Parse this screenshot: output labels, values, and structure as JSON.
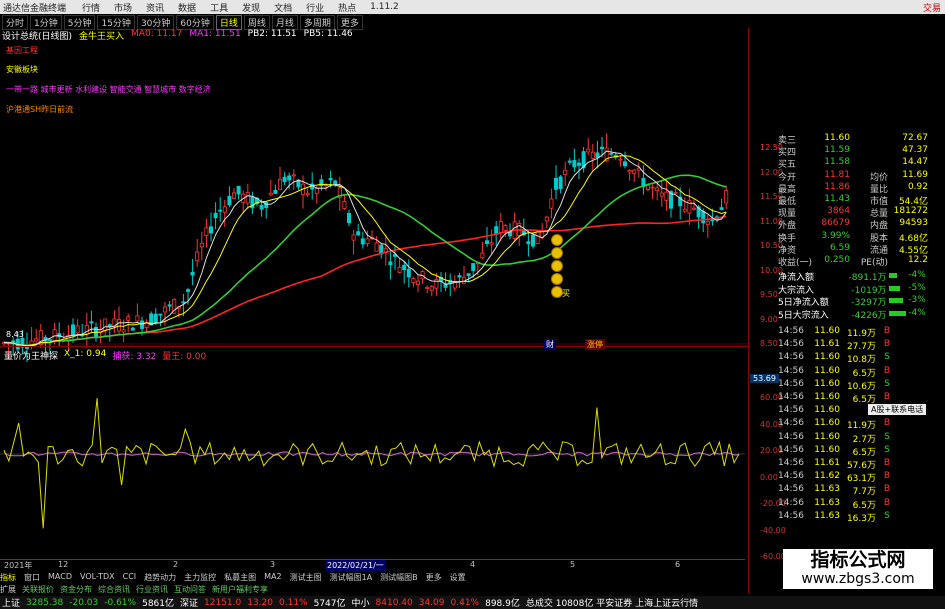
{
  "titlebar": {
    "app": "通达信金融终端",
    "menus": [
      "行情",
      "市场",
      "资讯",
      "数据",
      "工具",
      "发现",
      "文档",
      "行业",
      "热点",
      "1.11.2"
    ],
    "right": "交易"
  },
  "periods": [
    "分时",
    "1分钟",
    "5分钟",
    "15分钟",
    "30分钟",
    "60分钟",
    "日线",
    "周线",
    "月线",
    "多周期",
    "更多"
  ],
  "indicator_line": {
    "name": "设计总统(日线图)",
    "main": "金牛王买入",
    "ma0": "MA0: 11.17",
    "ma1": "MA1: 11.51",
    "pb2": "PB2: 11.51",
    "pb5": "PB5: 11.46"
  },
  "annotations": {
    "concept": "基因工程",
    "block": "安徽板块",
    "themes": "一带一路 城市更新 水利建设 智能交通 智慧城市 数字经济",
    "hsgt": "沪港通SH昨日前流"
  },
  "axis_main": [
    "12.50",
    "12.00",
    "11.50",
    "11.00",
    "10.50",
    "10.00",
    "9.50",
    "9.00",
    "8.50"
  ],
  "axis_sub": [
    "60.00",
    "40.00",
    "20.00",
    "0.00",
    "-20.00",
    "-40.00",
    "-60.00"
  ],
  "chart_price_low": "8.43",
  "buy_mark": "买",
  "markers": [
    "财",
    "涨停"
  ],
  "sub_indicator": {
    "name": "量价为王神探",
    "x1": "X_1: 0.94",
    "leader": "捕获: 3.32",
    "key": "量王: 0.00",
    "right_value": "53.69"
  },
  "date_labels": [
    "2021年",
    "12",
    "2",
    "3",
    "4",
    "5",
    "6"
  ],
  "date_cursor": "2022/02/21/一",
  "quote": [
    {
      "l": "卖三",
      "p": "11.60",
      "v": "72.67"
    },
    {
      "l": "买四",
      "p": "11.59",
      "v": "47.37"
    },
    {
      "l": "买五",
      "p": "11.58",
      "v": "14.47"
    },
    {
      "l": "今开",
      "p": "11.81",
      "l2": "均价",
      "v": "11.69"
    },
    {
      "l": "最高",
      "p": "11.86",
      "l2": "量比",
      "v": "0.92"
    },
    {
      "l": "最低",
      "p": "11.43",
      "l2": "市值",
      "v": "54.4亿"
    },
    {
      "l": "现量",
      "p": "3864",
      "l2": "总量",
      "v": "181272"
    },
    {
      "l": "外盘",
      "p": "86679",
      "l2": "内盘",
      "v": "94593"
    },
    {
      "l": "换手",
      "p": "3.99%",
      "l2": "股本",
      "v": "4.68亿"
    },
    {
      "l": "净资",
      "p": "6.59",
      "l2": "流通",
      "v": "4.55亿"
    },
    {
      "l": "收益(一)",
      "p": "0.250",
      "l2": "PE(动)",
      "v": "12.2"
    }
  ],
  "flow": [
    {
      "l": "净流入额",
      "v": "-891.1万",
      "p": "-4%"
    },
    {
      "l": "大宗流入",
      "v": "-1019万",
      "p": "-5%"
    },
    {
      "l": "5日净流入额",
      "v": "-3297万",
      "p": "-3%"
    },
    {
      "l": "5日大宗流入",
      "v": "-4226万",
      "p": "-4%"
    }
  ],
  "ticks": [
    {
      "t": "14:56",
      "p": "11.60",
      "v": "11.9万",
      "d": "B"
    },
    {
      "t": "14:56",
      "p": "11.61",
      "v": "27.7万",
      "d": "B"
    },
    {
      "t": "14:56",
      "p": "11.60",
      "v": "10.8万",
      "d": "S"
    },
    {
      "t": "14:56",
      "p": "11.60",
      "v": "6.5万",
      "d": "B"
    },
    {
      "t": "14:56",
      "p": "11.60",
      "v": "10.6万",
      "d": "S"
    },
    {
      "t": "14:56",
      "p": "11.60",
      "v": "6.5万",
      "d": "B"
    },
    {
      "t": "14:56",
      "p": "11.60",
      "v": "",
      "d": ""
    },
    {
      "t": "14:56",
      "p": "11.60",
      "v": "11.9万",
      "d": "B"
    },
    {
      "t": "14:56",
      "p": "11.60",
      "v": "2.7万",
      "d": "S"
    },
    {
      "t": "14:56",
      "p": "11.60",
      "v": "6.5万",
      "d": "S"
    },
    {
      "t": "14:56",
      "p": "11.61",
      "v": "57.6万",
      "d": "B"
    },
    {
      "t": "14:56",
      "p": "11.62",
      "v": "63.1万",
      "d": "B"
    },
    {
      "t": "14:56",
      "p": "11.63",
      "v": "7.7万",
      "d": "B"
    },
    {
      "t": "14:56",
      "p": "11.63",
      "v": "6.5万",
      "d": "B"
    },
    {
      "t": "14:56",
      "p": "11.63",
      "v": "16.3万",
      "d": "S"
    }
  ],
  "popup": "A股+联系电话",
  "bottom_tabs": [
    "指标",
    "窗口",
    "MACD",
    "VOL-TDX",
    "CCI",
    "趋势动力",
    "主力监控",
    "私募主图",
    "MA2",
    "测试主图",
    "测试幅图1A",
    "测试幅图B",
    "更多",
    "设置"
  ],
  "bottom_tabs2": [
    "扩展",
    "关联报价",
    "资金分布",
    "综合资讯",
    "行业资讯",
    "互动问答",
    "新用户福利专享"
  ],
  "ticker": [
    {
      "n": "上证",
      "v": "3285.38",
      "c": "-20.03",
      "p": "-0.61%",
      "a": "5861亿"
    },
    {
      "n": "深证",
      "v": "12151.0",
      "c": "13.20",
      "p": "0.11%",
      "a": "5747亿"
    },
    {
      "n": "中小",
      "v": "8410.40",
      "c": "34.09",
      "p": "0.41%",
      "a": "898.9亿"
    }
  ],
  "ticker_extra": "总成交 10808亿 平安证券 上海上证云行情",
  "logo": {
    "title": "指标公式网",
    "url": "www.zbgs3.com"
  },
  "colors": {
    "up": "#ff3333",
    "down": "#00cccc",
    "ma_short": "#ffffff",
    "ma_mid": "#ffff00",
    "ma_long": "#33cc33",
    "ma_trend": "#ff2222"
  }
}
